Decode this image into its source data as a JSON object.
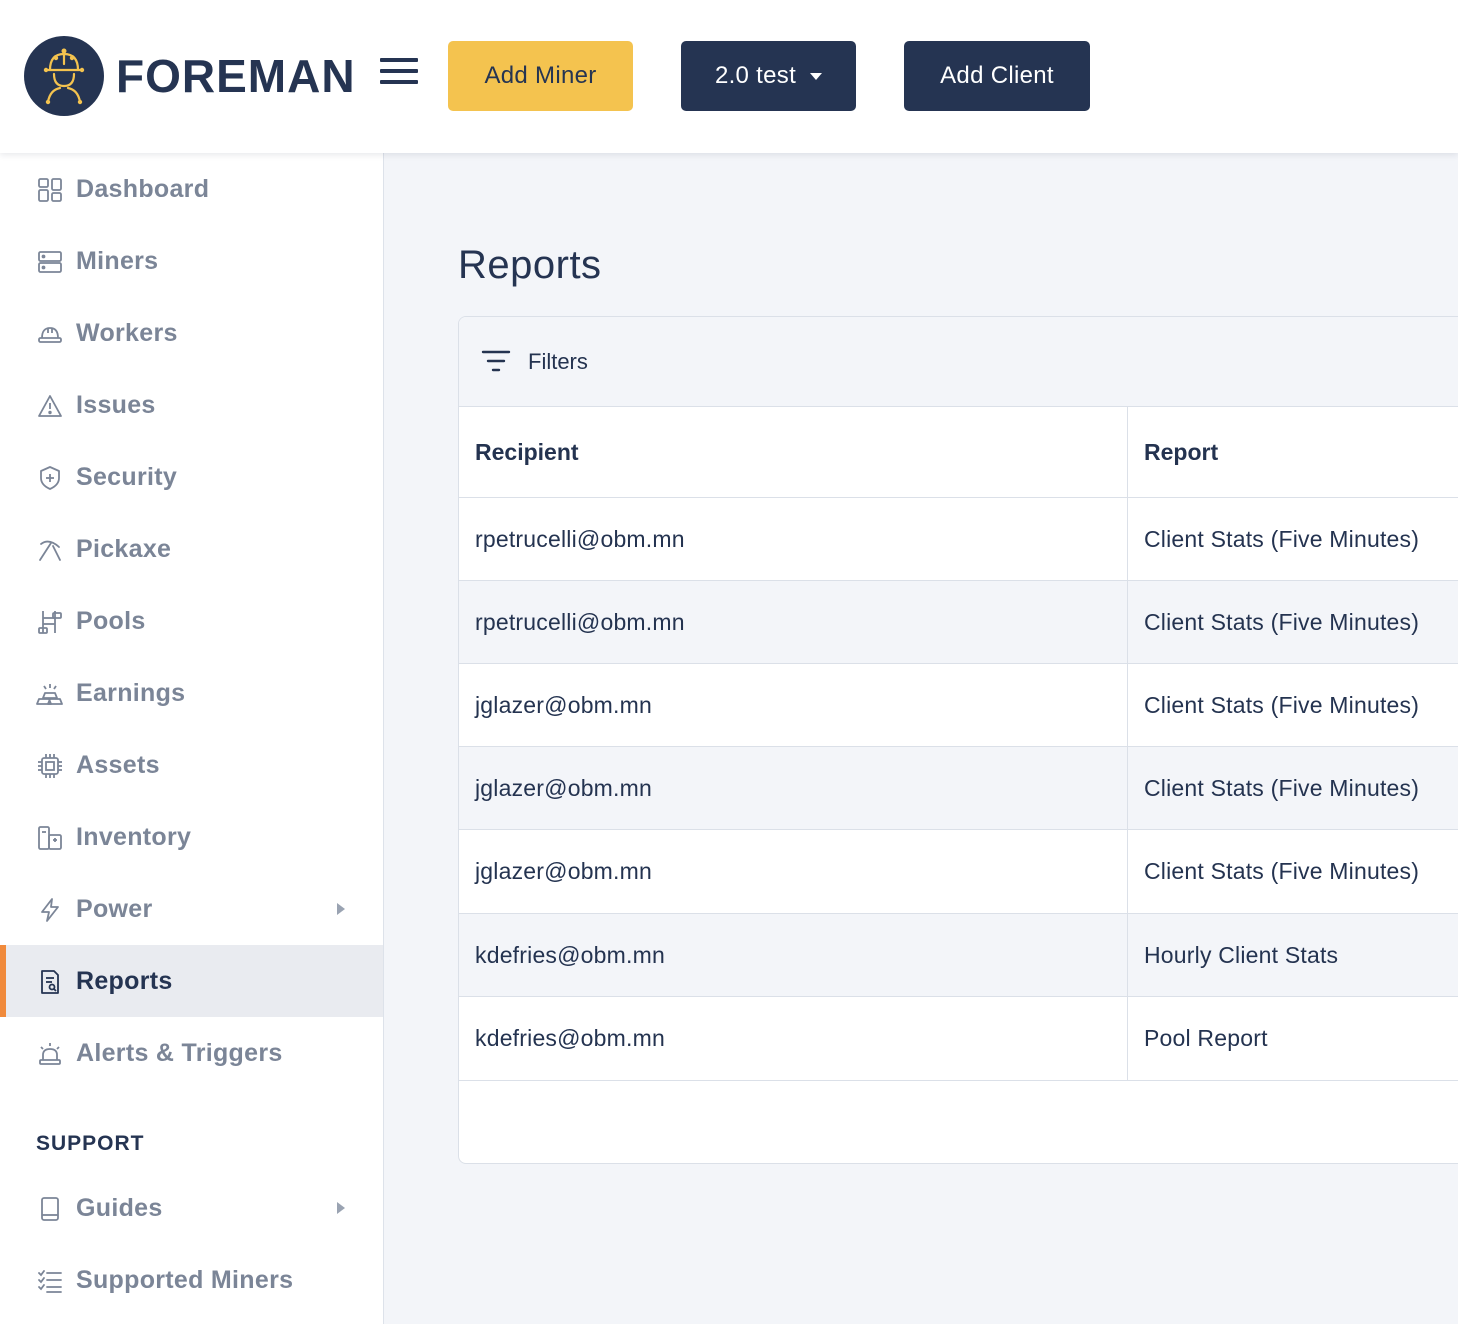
{
  "header": {
    "logo_text": "FOREMAN",
    "add_miner_label": "Add Miner",
    "environment_label": "2.0 test",
    "add_client_label": "Add Client"
  },
  "sidebar": {
    "items": [
      {
        "label": "Dashboard",
        "icon": "dashboard-icon"
      },
      {
        "label": "Miners",
        "icon": "server-icon"
      },
      {
        "label": "Workers",
        "icon": "hardhat-icon"
      },
      {
        "label": "Issues",
        "icon": "warning-icon"
      },
      {
        "label": "Security",
        "icon": "shield-icon"
      },
      {
        "label": "Pickaxe",
        "icon": "pickaxe-icon"
      },
      {
        "label": "Pools",
        "icon": "pools-icon"
      },
      {
        "label": "Earnings",
        "icon": "gold-bars-icon"
      },
      {
        "label": "Assets",
        "icon": "chip-icon"
      },
      {
        "label": "Inventory",
        "icon": "inventory-icon"
      },
      {
        "label": "Power",
        "icon": "lightning-icon"
      },
      {
        "label": "Reports",
        "icon": "report-icon"
      },
      {
        "label": "Alerts & Triggers",
        "icon": "alarm-icon"
      }
    ],
    "active_item": "Reports",
    "support_heading": "SUPPORT",
    "support_items": [
      {
        "label": "Guides",
        "icon": "book-icon"
      },
      {
        "label": "Supported Miners",
        "icon": "checklist-icon"
      }
    ]
  },
  "main": {
    "title": "Reports",
    "filters_label": "Filters",
    "columns": [
      "Recipient",
      "Report"
    ],
    "rows": [
      {
        "recipient": "rpetrucelli@obm.mn",
        "report": "Client Stats (Five Minutes)"
      },
      {
        "recipient": "rpetrucelli@obm.mn",
        "report": "Client Stats (Five Minutes)"
      },
      {
        "recipient": "jglazer@obm.mn",
        "report": "Client Stats (Five Minutes)"
      },
      {
        "recipient": "jglazer@obm.mn",
        "report": "Client Stats (Five Minutes)"
      },
      {
        "recipient": "jglazer@obm.mn",
        "report": "Client Stats (Five Minutes)"
      },
      {
        "recipient": "kdefries@obm.mn",
        "report": "Hourly Client Stats"
      },
      {
        "recipient": "kdefries@obm.mn",
        "report": "Pool Report"
      }
    ]
  },
  "colors": {
    "brand_navy": "#253452",
    "accent_yellow": "#f4c34f",
    "active_indicator": "#f08a3c",
    "muted_text": "#7b8597"
  }
}
